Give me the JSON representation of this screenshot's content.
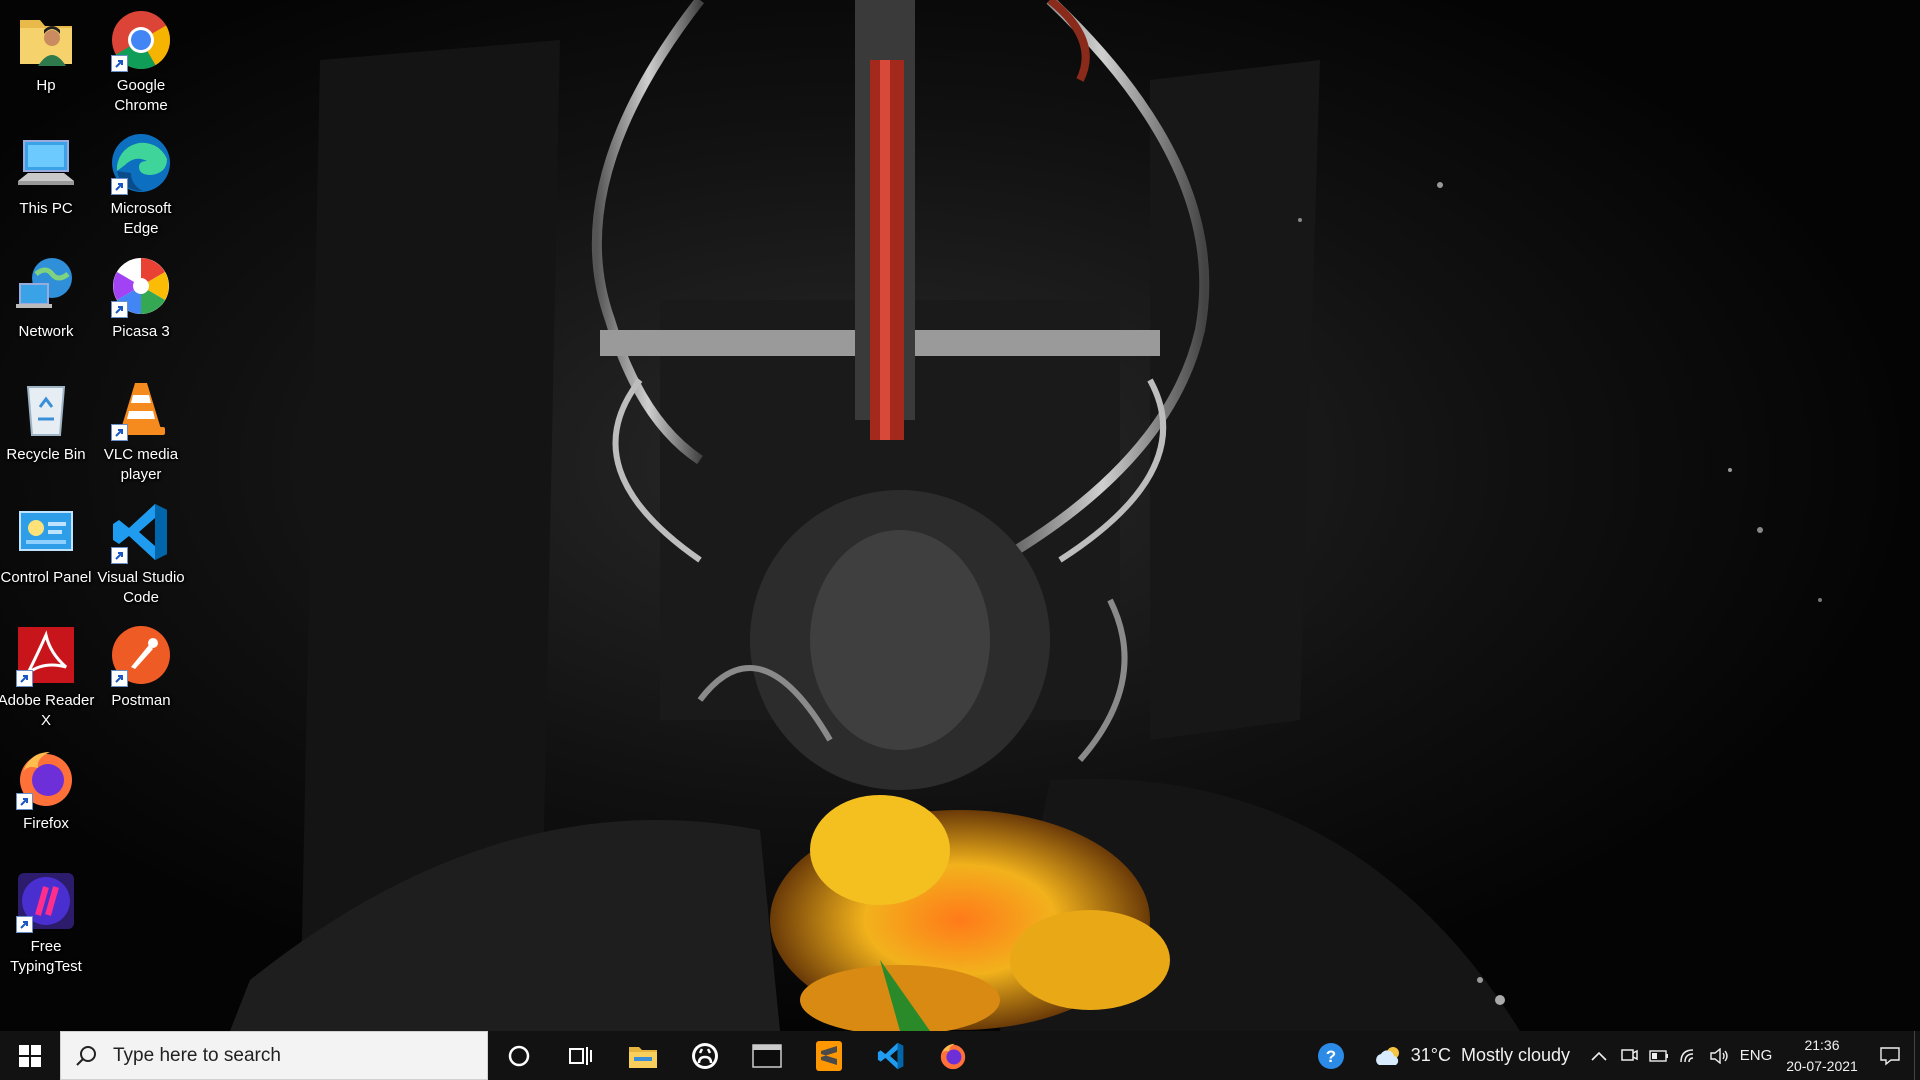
{
  "desktop": {
    "icons": [
      {
        "label": "Hp",
        "icon": "user-folder-icon",
        "shortcut": false
      },
      {
        "label": "Google Chrome",
        "icon": "chrome-icon",
        "shortcut": true
      },
      {
        "label": "This PC",
        "icon": "computer-icon",
        "shortcut": false
      },
      {
        "label": "Microsoft Edge",
        "icon": "edge-icon",
        "shortcut": true
      },
      {
        "label": "Network",
        "icon": "network-icon",
        "shortcut": false
      },
      {
        "label": "Picasa 3",
        "icon": "picasa-icon",
        "shortcut": true
      },
      {
        "label": "Recycle Bin",
        "icon": "recycle-bin-icon",
        "shortcut": false
      },
      {
        "label": "VLC media player",
        "icon": "vlc-icon",
        "shortcut": true
      },
      {
        "label": "Control Panel",
        "icon": "control-panel-icon",
        "shortcut": false
      },
      {
        "label": "Visual Studio Code",
        "icon": "vscode-icon",
        "shortcut": true
      },
      {
        "label": "Adobe Reader X",
        "icon": "adobe-reader-icon",
        "shortcut": true
      },
      {
        "label": "Postman",
        "icon": "postman-icon",
        "shortcut": true
      },
      {
        "label": "Firefox",
        "icon": "firefox-icon",
        "shortcut": true
      },
      {
        "label": "Free TypingTest",
        "icon": "typing-test-icon",
        "shortcut": true
      }
    ]
  },
  "taskbar": {
    "search_placeholder": "Type here to search",
    "pinned": [
      "cortana-icon",
      "task-view-icon",
      "file-explorer-icon",
      "github-icon",
      "terminal-icon",
      "sublime-text-icon",
      "vscode-icon",
      "firefox-icon"
    ],
    "help_icon": "help-icon",
    "weather": {
      "temp": "31°C",
      "condition": "Mostly cloudy"
    },
    "tray": [
      "show-hidden-icons-chevron",
      "meet-now-icon",
      "battery-icon",
      "wifi-icon",
      "volume-icon"
    ],
    "language": "ENG",
    "time": "21:36",
    "date": "20-07-2021",
    "notification_icon": "action-center-icon"
  },
  "colors": {
    "taskbar": "#121212",
    "search_box": "#f3f3f3",
    "wallpaper_base": "#050505"
  }
}
